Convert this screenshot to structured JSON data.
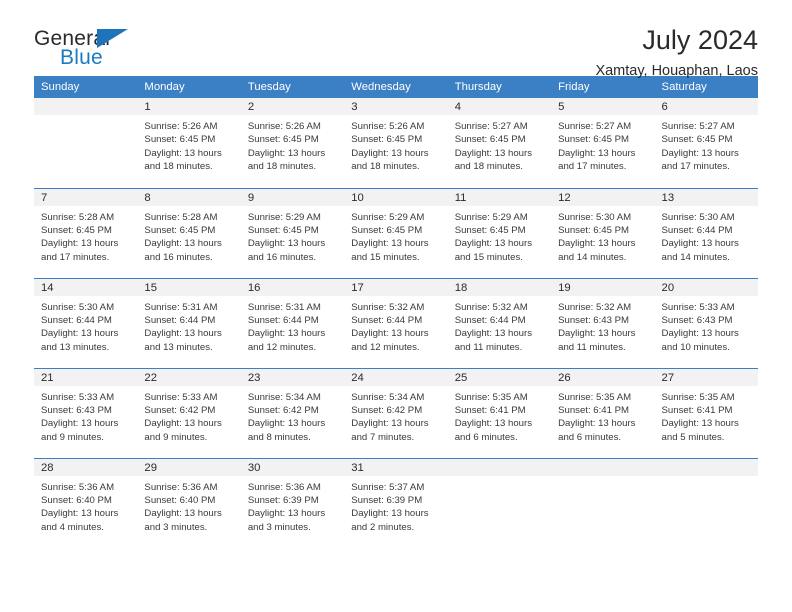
{
  "brand": {
    "name_part1": "General",
    "name_part2": "Blue",
    "accent_color": "#1e7ac0",
    "triangle_color": "#1e74bb"
  },
  "header": {
    "title": "July 2024",
    "subtitle": "Xamtay, Houaphan, Laos"
  },
  "calendar": {
    "header_bg": "#3b7fc4",
    "weekday_headers": [
      "Sunday",
      "Monday",
      "Tuesday",
      "Wednesday",
      "Thursday",
      "Friday",
      "Saturday"
    ],
    "weeks": [
      [
        {
          "day": "",
          "sunrise": "",
          "sunset": "",
          "daylight1": "",
          "daylight2": ""
        },
        {
          "day": "1",
          "sunrise": "Sunrise: 5:26 AM",
          "sunset": "Sunset: 6:45 PM",
          "daylight1": "Daylight: 13 hours",
          "daylight2": "and 18 minutes."
        },
        {
          "day": "2",
          "sunrise": "Sunrise: 5:26 AM",
          "sunset": "Sunset: 6:45 PM",
          "daylight1": "Daylight: 13 hours",
          "daylight2": "and 18 minutes."
        },
        {
          "day": "3",
          "sunrise": "Sunrise: 5:26 AM",
          "sunset": "Sunset: 6:45 PM",
          "daylight1": "Daylight: 13 hours",
          "daylight2": "and 18 minutes."
        },
        {
          "day": "4",
          "sunrise": "Sunrise: 5:27 AM",
          "sunset": "Sunset: 6:45 PM",
          "daylight1": "Daylight: 13 hours",
          "daylight2": "and 18 minutes."
        },
        {
          "day": "5",
          "sunrise": "Sunrise: 5:27 AM",
          "sunset": "Sunset: 6:45 PM",
          "daylight1": "Daylight: 13 hours",
          "daylight2": "and 17 minutes."
        },
        {
          "day": "6",
          "sunrise": "Sunrise: 5:27 AM",
          "sunset": "Sunset: 6:45 PM",
          "daylight1": "Daylight: 13 hours",
          "daylight2": "and 17 minutes."
        }
      ],
      [
        {
          "day": "7",
          "sunrise": "Sunrise: 5:28 AM",
          "sunset": "Sunset: 6:45 PM",
          "daylight1": "Daylight: 13 hours",
          "daylight2": "and 17 minutes."
        },
        {
          "day": "8",
          "sunrise": "Sunrise: 5:28 AM",
          "sunset": "Sunset: 6:45 PM",
          "daylight1": "Daylight: 13 hours",
          "daylight2": "and 16 minutes."
        },
        {
          "day": "9",
          "sunrise": "Sunrise: 5:29 AM",
          "sunset": "Sunset: 6:45 PM",
          "daylight1": "Daylight: 13 hours",
          "daylight2": "and 16 minutes."
        },
        {
          "day": "10",
          "sunrise": "Sunrise: 5:29 AM",
          "sunset": "Sunset: 6:45 PM",
          "daylight1": "Daylight: 13 hours",
          "daylight2": "and 15 minutes."
        },
        {
          "day": "11",
          "sunrise": "Sunrise: 5:29 AM",
          "sunset": "Sunset: 6:45 PM",
          "daylight1": "Daylight: 13 hours",
          "daylight2": "and 15 minutes."
        },
        {
          "day": "12",
          "sunrise": "Sunrise: 5:30 AM",
          "sunset": "Sunset: 6:45 PM",
          "daylight1": "Daylight: 13 hours",
          "daylight2": "and 14 minutes."
        },
        {
          "day": "13",
          "sunrise": "Sunrise: 5:30 AM",
          "sunset": "Sunset: 6:44 PM",
          "daylight1": "Daylight: 13 hours",
          "daylight2": "and 14 minutes."
        }
      ],
      [
        {
          "day": "14",
          "sunrise": "Sunrise: 5:30 AM",
          "sunset": "Sunset: 6:44 PM",
          "daylight1": "Daylight: 13 hours",
          "daylight2": "and 13 minutes."
        },
        {
          "day": "15",
          "sunrise": "Sunrise: 5:31 AM",
          "sunset": "Sunset: 6:44 PM",
          "daylight1": "Daylight: 13 hours",
          "daylight2": "and 13 minutes."
        },
        {
          "day": "16",
          "sunrise": "Sunrise: 5:31 AM",
          "sunset": "Sunset: 6:44 PM",
          "daylight1": "Daylight: 13 hours",
          "daylight2": "and 12 minutes."
        },
        {
          "day": "17",
          "sunrise": "Sunrise: 5:32 AM",
          "sunset": "Sunset: 6:44 PM",
          "daylight1": "Daylight: 13 hours",
          "daylight2": "and 12 minutes."
        },
        {
          "day": "18",
          "sunrise": "Sunrise: 5:32 AM",
          "sunset": "Sunset: 6:44 PM",
          "daylight1": "Daylight: 13 hours",
          "daylight2": "and 11 minutes."
        },
        {
          "day": "19",
          "sunrise": "Sunrise: 5:32 AM",
          "sunset": "Sunset: 6:43 PM",
          "daylight1": "Daylight: 13 hours",
          "daylight2": "and 11 minutes."
        },
        {
          "day": "20",
          "sunrise": "Sunrise: 5:33 AM",
          "sunset": "Sunset: 6:43 PM",
          "daylight1": "Daylight: 13 hours",
          "daylight2": "and 10 minutes."
        }
      ],
      [
        {
          "day": "21",
          "sunrise": "Sunrise: 5:33 AM",
          "sunset": "Sunset: 6:43 PM",
          "daylight1": "Daylight: 13 hours",
          "daylight2": "and 9 minutes."
        },
        {
          "day": "22",
          "sunrise": "Sunrise: 5:33 AM",
          "sunset": "Sunset: 6:42 PM",
          "daylight1": "Daylight: 13 hours",
          "daylight2": "and 9 minutes."
        },
        {
          "day": "23",
          "sunrise": "Sunrise: 5:34 AM",
          "sunset": "Sunset: 6:42 PM",
          "daylight1": "Daylight: 13 hours",
          "daylight2": "and 8 minutes."
        },
        {
          "day": "24",
          "sunrise": "Sunrise: 5:34 AM",
          "sunset": "Sunset: 6:42 PM",
          "daylight1": "Daylight: 13 hours",
          "daylight2": "and 7 minutes."
        },
        {
          "day": "25",
          "sunrise": "Sunrise: 5:35 AM",
          "sunset": "Sunset: 6:41 PM",
          "daylight1": "Daylight: 13 hours",
          "daylight2": "and 6 minutes."
        },
        {
          "day": "26",
          "sunrise": "Sunrise: 5:35 AM",
          "sunset": "Sunset: 6:41 PM",
          "daylight1": "Daylight: 13 hours",
          "daylight2": "and 6 minutes."
        },
        {
          "day": "27",
          "sunrise": "Sunrise: 5:35 AM",
          "sunset": "Sunset: 6:41 PM",
          "daylight1": "Daylight: 13 hours",
          "daylight2": "and 5 minutes."
        }
      ],
      [
        {
          "day": "28",
          "sunrise": "Sunrise: 5:36 AM",
          "sunset": "Sunset: 6:40 PM",
          "daylight1": "Daylight: 13 hours",
          "daylight2": "and 4 minutes."
        },
        {
          "day": "29",
          "sunrise": "Sunrise: 5:36 AM",
          "sunset": "Sunset: 6:40 PM",
          "daylight1": "Daylight: 13 hours",
          "daylight2": "and 3 minutes."
        },
        {
          "day": "30",
          "sunrise": "Sunrise: 5:36 AM",
          "sunset": "Sunset: 6:39 PM",
          "daylight1": "Daylight: 13 hours",
          "daylight2": "and 3 minutes."
        },
        {
          "day": "31",
          "sunrise": "Sunrise: 5:37 AM",
          "sunset": "Sunset: 6:39 PM",
          "daylight1": "Daylight: 13 hours",
          "daylight2": "and 2 minutes."
        },
        {
          "day": "",
          "sunrise": "",
          "sunset": "",
          "daylight1": "",
          "daylight2": ""
        },
        {
          "day": "",
          "sunrise": "",
          "sunset": "",
          "daylight1": "",
          "daylight2": ""
        },
        {
          "day": "",
          "sunrise": "",
          "sunset": "",
          "daylight1": "",
          "daylight2": ""
        }
      ]
    ]
  }
}
